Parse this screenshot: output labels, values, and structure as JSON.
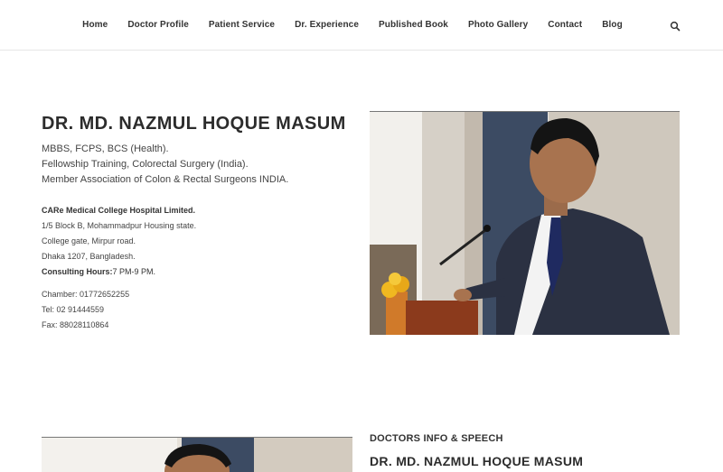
{
  "nav": {
    "items": [
      {
        "label": "Home"
      },
      {
        "label": "Doctor Profile"
      },
      {
        "label": "Patient Service"
      },
      {
        "label": "Dr. Experience"
      },
      {
        "label": "Published Book"
      },
      {
        "label": "Photo Gallery"
      },
      {
        "label": "Contact"
      },
      {
        "label": "Blog"
      }
    ],
    "search_icon": "search-icon"
  },
  "profile": {
    "name": "DR. MD. NAZMUL HOQUE MASUM",
    "qualifications": [
      "MBBS, FCPS, BCS (Health).",
      "Fellowship Training, Colorectal Surgery (India).",
      "Member Association of Colon & Rectal Surgeons INDIA."
    ],
    "hospital": "CARe Medical College Hospital Limited.",
    "address_lines": [
      "1/5 Block B, Mohammadpur Housing state.",
      "College gate, Mirpur road.",
      "Dhaka 1207, Bangladesh."
    ],
    "hours_label": "Consulting Hours:",
    "hours_value": "7 PM-9 PM.",
    "chamber": "Chamber: 01772652255",
    "tel": "Tel: 02 91444559",
    "fax": "Fax: 88028110864"
  },
  "info_section": {
    "heading": "DOCTORS INFO & SPEECH",
    "name": "DR. MD. NAZMUL HOQUE MASUM"
  },
  "colors": {
    "text": "#333333",
    "border": "#e6e6e6",
    "suit": "#2b3142",
    "wall": "#c9c4bb"
  }
}
